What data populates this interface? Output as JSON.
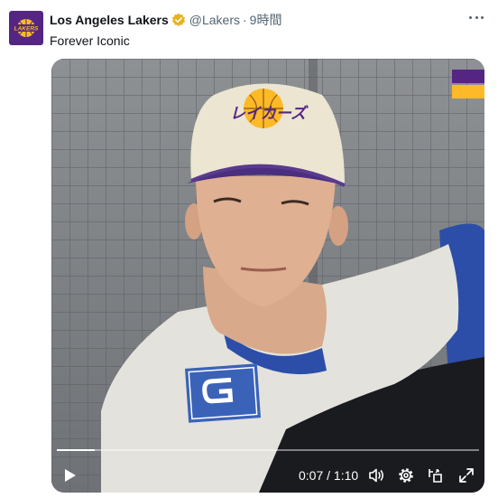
{
  "tweet": {
    "author_name": "Los Angeles Lakers",
    "handle": "@Lakers",
    "separator": "·",
    "time": "9時間",
    "text": "Forever Iconic",
    "avatar_text": "LAKERS"
  },
  "cap_logo_text": "レイカーズ",
  "video": {
    "current_time": "0:07",
    "time_separator": "/",
    "duration": "1:10",
    "progress_fraction": 0.09
  },
  "icons": {
    "verified": "verified-badge-icon",
    "more": "more-options-icon",
    "play": "play-icon",
    "volume": "volume-icon",
    "settings": "settings-gear-icon",
    "popout": "popout-icon",
    "fullscreen": "fullscreen-icon"
  },
  "colors": {
    "lakers_purple": "#552583",
    "lakers_gold": "#fdb927",
    "verified_gold": "#e8b21a"
  }
}
